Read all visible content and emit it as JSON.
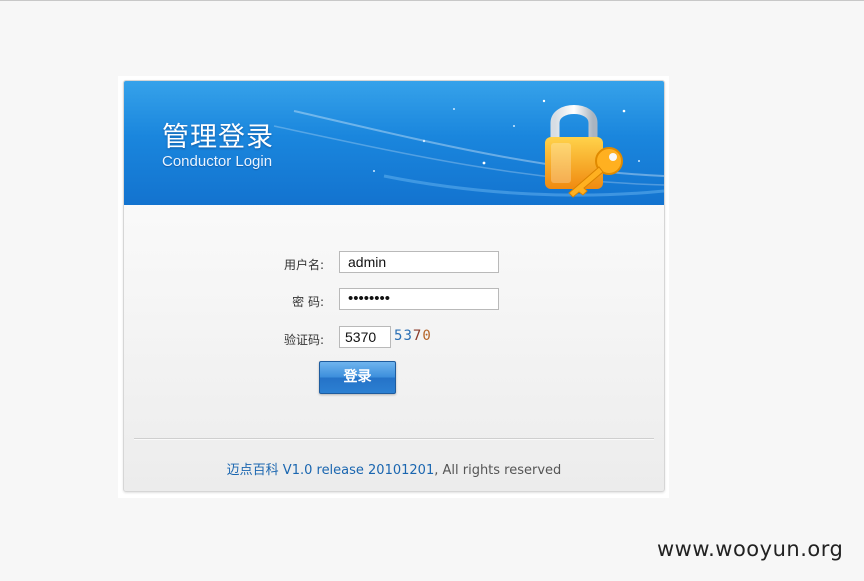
{
  "header": {
    "title_cn": "管理登录",
    "title_en": "Conductor Login",
    "icon": "lock-and-key-icon"
  },
  "form": {
    "username_label": "用户名:",
    "username_value": "admin",
    "password_label": "密  码:",
    "password_value": "••••••••",
    "captcha_label": "验证码:",
    "captcha_value": "5370",
    "captcha_image_chars": [
      "5",
      "3",
      "7",
      "0"
    ],
    "captcha_colors": [
      "#2a6fb5",
      "#2a6fb5",
      "#8a3a2a",
      "#b5652a"
    ],
    "login_button": "登录"
  },
  "footer": {
    "link_text": "迈点百科 V1.0 release 20101201",
    "suffix": ", All rights reserved"
  },
  "watermark": "www.wooyun.org",
  "colors": {
    "banner": "#1a86dd",
    "button": "#2c80d2",
    "link": "#1a66b0"
  }
}
